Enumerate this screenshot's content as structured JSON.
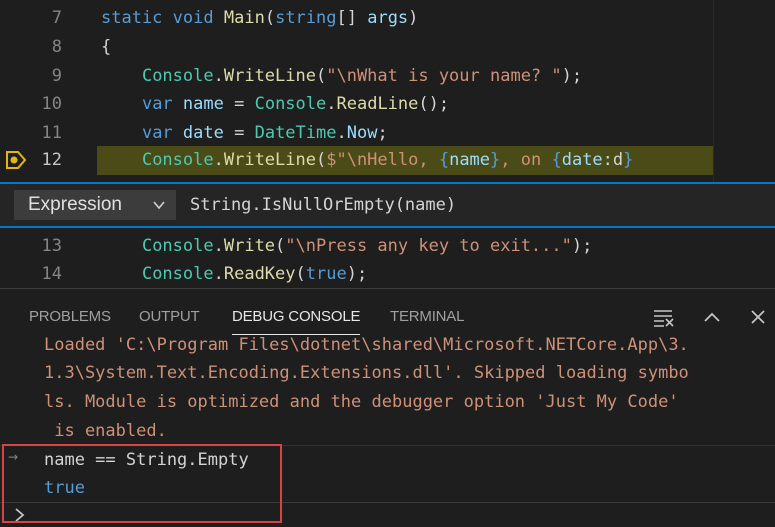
{
  "editor": {
    "lines": [
      {
        "num": "7",
        "segs": [
          {
            "t": "static",
            "c": "kw"
          },
          {
            "t": " ",
            "c": "pu"
          },
          {
            "t": "void",
            "c": "kw"
          },
          {
            "t": " ",
            "c": "pu"
          },
          {
            "t": "Main",
            "c": "fn"
          },
          {
            "t": "(",
            "c": "pu"
          },
          {
            "t": "string",
            "c": "kw"
          },
          {
            "t": "[] ",
            "c": "pu"
          },
          {
            "t": "args",
            "c": "pa"
          },
          {
            "t": ")",
            "c": "pu"
          }
        ]
      },
      {
        "num": "8",
        "segs": [
          {
            "t": "{",
            "c": "pu"
          }
        ]
      },
      {
        "num": "9",
        "segs": [
          {
            "t": "    ",
            "c": "pu"
          },
          {
            "t": "Console",
            "c": "ty"
          },
          {
            "t": ".",
            "c": "pu"
          },
          {
            "t": "WriteLine",
            "c": "fn"
          },
          {
            "t": "(",
            "c": "pu"
          },
          {
            "t": "\"\\nWhat is your name? \"",
            "c": "st"
          },
          {
            "t": ");",
            "c": "pu"
          }
        ]
      },
      {
        "num": "10",
        "segs": [
          {
            "t": "    ",
            "c": "pu"
          },
          {
            "t": "var",
            "c": "kw"
          },
          {
            "t": " ",
            "c": "pu"
          },
          {
            "t": "name",
            "c": "pa"
          },
          {
            "t": " = ",
            "c": "pu"
          },
          {
            "t": "Console",
            "c": "ty"
          },
          {
            "t": ".",
            "c": "pu"
          },
          {
            "t": "ReadLine",
            "c": "fn"
          },
          {
            "t": "();",
            "c": "pu"
          }
        ]
      },
      {
        "num": "11",
        "segs": [
          {
            "t": "    ",
            "c": "pu"
          },
          {
            "t": "var",
            "c": "kw"
          },
          {
            "t": " ",
            "c": "pu"
          },
          {
            "t": "date",
            "c": "pa"
          },
          {
            "t": " = ",
            "c": "pu"
          },
          {
            "t": "DateTime",
            "c": "ty"
          },
          {
            "t": ".",
            "c": "pu"
          },
          {
            "t": "Now",
            "c": "pa"
          },
          {
            "t": ";",
            "c": "pu"
          }
        ]
      },
      {
        "num": "12",
        "current": true,
        "segs": [
          {
            "t": "    ",
            "c": "pu"
          },
          {
            "t": "Console",
            "c": "ty"
          },
          {
            "t": ".",
            "c": "pu"
          },
          {
            "t": "WriteLine",
            "c": "fn"
          },
          {
            "t": "(",
            "c": "pu"
          },
          {
            "t": "$\"\\nHello, ",
            "c": "st"
          },
          {
            "t": "{",
            "c": "kw"
          },
          {
            "t": "name",
            "c": "pa"
          },
          {
            "t": "}",
            "c": "kw"
          },
          {
            "t": ", on ",
            "c": "st"
          },
          {
            "t": "{",
            "c": "kw"
          },
          {
            "t": "date",
            "c": "pa"
          },
          {
            "t": ":d",
            "c": "pu"
          },
          {
            "t": "}",
            "c": "kw"
          }
        ]
      },
      {
        "num": "13",
        "segs": [
          {
            "t": "    ",
            "c": "pu"
          },
          {
            "t": "Console",
            "c": "ty"
          },
          {
            "t": ".",
            "c": "pu"
          },
          {
            "t": "Write",
            "c": "fn"
          },
          {
            "t": "(",
            "c": "pu"
          },
          {
            "t": "\"\\nPress any key to exit...\"",
            "c": "st"
          },
          {
            "t": ");",
            "c": "pu"
          }
        ]
      },
      {
        "num": "14",
        "segs": [
          {
            "t": "    ",
            "c": "pu"
          },
          {
            "t": "Console",
            "c": "ty"
          },
          {
            "t": ".",
            "c": "pu"
          },
          {
            "t": "ReadKey",
            "c": "fn"
          },
          {
            "t": "(",
            "c": "pu"
          },
          {
            "t": "true",
            "c": "kw"
          },
          {
            "t": ");",
            "c": "pu"
          }
        ]
      }
    ]
  },
  "breakpoint_widget": {
    "type_label": "Expression",
    "expression": "String.IsNullOrEmpty(name)"
  },
  "panel": {
    "tabs": [
      {
        "label": "PROBLEMS",
        "active": false
      },
      {
        "label": "OUTPUT",
        "active": false
      },
      {
        "label": "DEBUG CONSOLE",
        "active": true
      },
      {
        "label": "TERMINAL",
        "active": false
      }
    ],
    "console_output": [
      "Loaded 'C:\\Program Files\\dotnet\\shared\\Microsoft.NETCore.App\\3.",
      "1.3\\System.Text.Encoding.Extensions.dll'. Skipped loading symbo",
      "ls. Module is optimized and the debugger option 'Just My Code'",
      " is enabled."
    ],
    "evaluation": {
      "input": "name == String.Empty",
      "result": "true"
    },
    "colors": {
      "result": "#569cd6",
      "output": "#ce9178",
      "highlight_box": "#d84343"
    }
  }
}
